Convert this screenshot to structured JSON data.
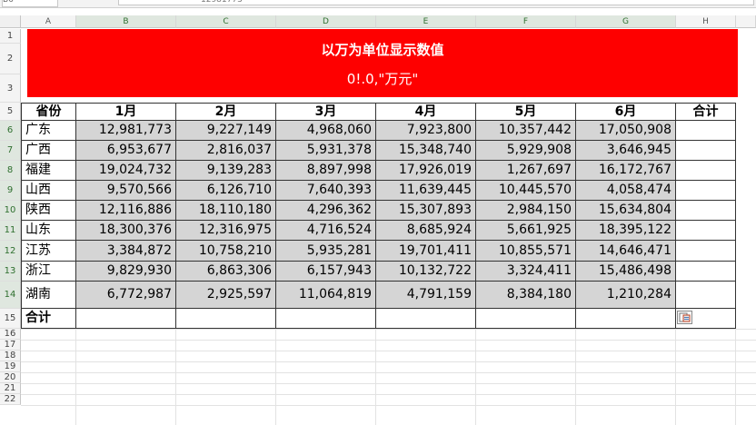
{
  "formula_bar": {
    "name_box": "B6",
    "formula": "12981773"
  },
  "columns": [
    "A",
    "B",
    "C",
    "D",
    "E",
    "F",
    "G",
    "H"
  ],
  "rows": [
    "1",
    "2",
    "3",
    "5",
    "6",
    "7",
    "8",
    "9",
    "10",
    "11",
    "12",
    "13",
    "14",
    "15",
    "16",
    "17",
    "18",
    "19",
    "20",
    "21",
    "22"
  ],
  "title": {
    "line1": "以万为单位显示数值",
    "line2": "0!.0,\"万元\""
  },
  "table": {
    "header": [
      "省份",
      "1月",
      "2月",
      "3月",
      "4月",
      "5月",
      "6月",
      "合计"
    ],
    "rows": [
      {
        "province": "广东",
        "values": [
          "12,981,773",
          "9,227,149",
          "4,968,060",
          "7,923,800",
          "10,357,442",
          "17,050,908"
        ]
      },
      {
        "province": "广西",
        "values": [
          "6,953,677",
          "2,816,037",
          "5,931,378",
          "15,348,740",
          "5,929,908",
          "3,646,945"
        ]
      },
      {
        "province": "福建",
        "values": [
          "19,024,732",
          "9,139,283",
          "8,897,998",
          "17,926,019",
          "1,267,697",
          "16,172,767"
        ]
      },
      {
        "province": "山西",
        "values": [
          "9,570,566",
          "6,126,710",
          "7,640,393",
          "11,639,445",
          "10,445,570",
          "4,058,474"
        ]
      },
      {
        "province": "陕西",
        "values": [
          "12,116,886",
          "18,110,180",
          "4,296,362",
          "15,307,893",
          "2,984,150",
          "15,634,804"
        ]
      },
      {
        "province": "山东",
        "values": [
          "18,300,376",
          "12,316,975",
          "4,716,524",
          "8,685,924",
          "5,661,925",
          "18,395,122"
        ]
      },
      {
        "province": "江苏",
        "values": [
          "3,384,872",
          "10,758,210",
          "5,935,281",
          "19,701,411",
          "10,855,571",
          "14,646,471"
        ]
      },
      {
        "province": "浙江",
        "values": [
          "9,829,930",
          "6,863,306",
          "6,157,943",
          "10,132,722",
          "3,324,411",
          "15,486,498"
        ]
      },
      {
        "province": "湖南",
        "values": [
          "6,772,987",
          "2,925,597",
          "11,064,819",
          "4,791,159",
          "8,384,180",
          "1,210,284"
        ]
      }
    ],
    "total_label": "合计"
  }
}
